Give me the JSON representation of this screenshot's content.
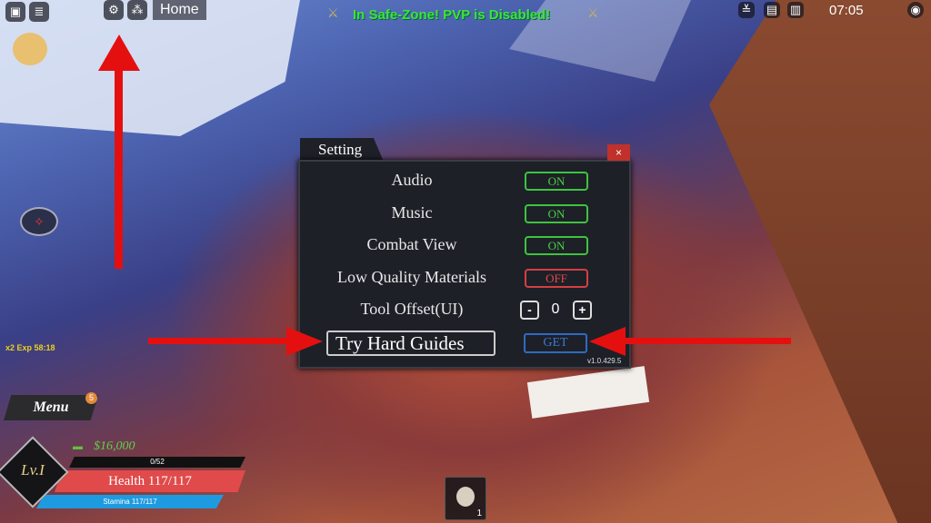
{
  "topbar": {
    "home_label": "Home",
    "clock": "07:05",
    "safe_zone": "In Safe-Zone! PVP is Disabled!"
  },
  "hud": {
    "exp_boost": "x2 Exp 58:18",
    "menu_label": "Menu",
    "menu_badge": "5",
    "money": "$16,000",
    "level": "Lv.I",
    "xp": "0/52",
    "health": "Health 117/117",
    "stamina": "Stamina 117/117",
    "hotbar_slot_number": "1"
  },
  "settings": {
    "title": "Setting",
    "close": "×",
    "rows": [
      {
        "label": "Audio",
        "value": "ON"
      },
      {
        "label": "Music",
        "value": "ON"
      },
      {
        "label": "Combat View",
        "value": "ON"
      },
      {
        "label": "Low Quality Materials",
        "value": "OFF"
      }
    ],
    "tool_offset": {
      "label": "Tool Offset(UI)",
      "minus": "-",
      "value": "0",
      "plus": "+"
    },
    "code_input": "Try Hard Guides",
    "get_label": "GET",
    "version": "v1.0.429.5"
  },
  "colors": {
    "on": "#48d048",
    "off": "#e24a4a",
    "arrow": "#e41010",
    "health": "#e04a4a",
    "stamina": "#1e9be0"
  }
}
